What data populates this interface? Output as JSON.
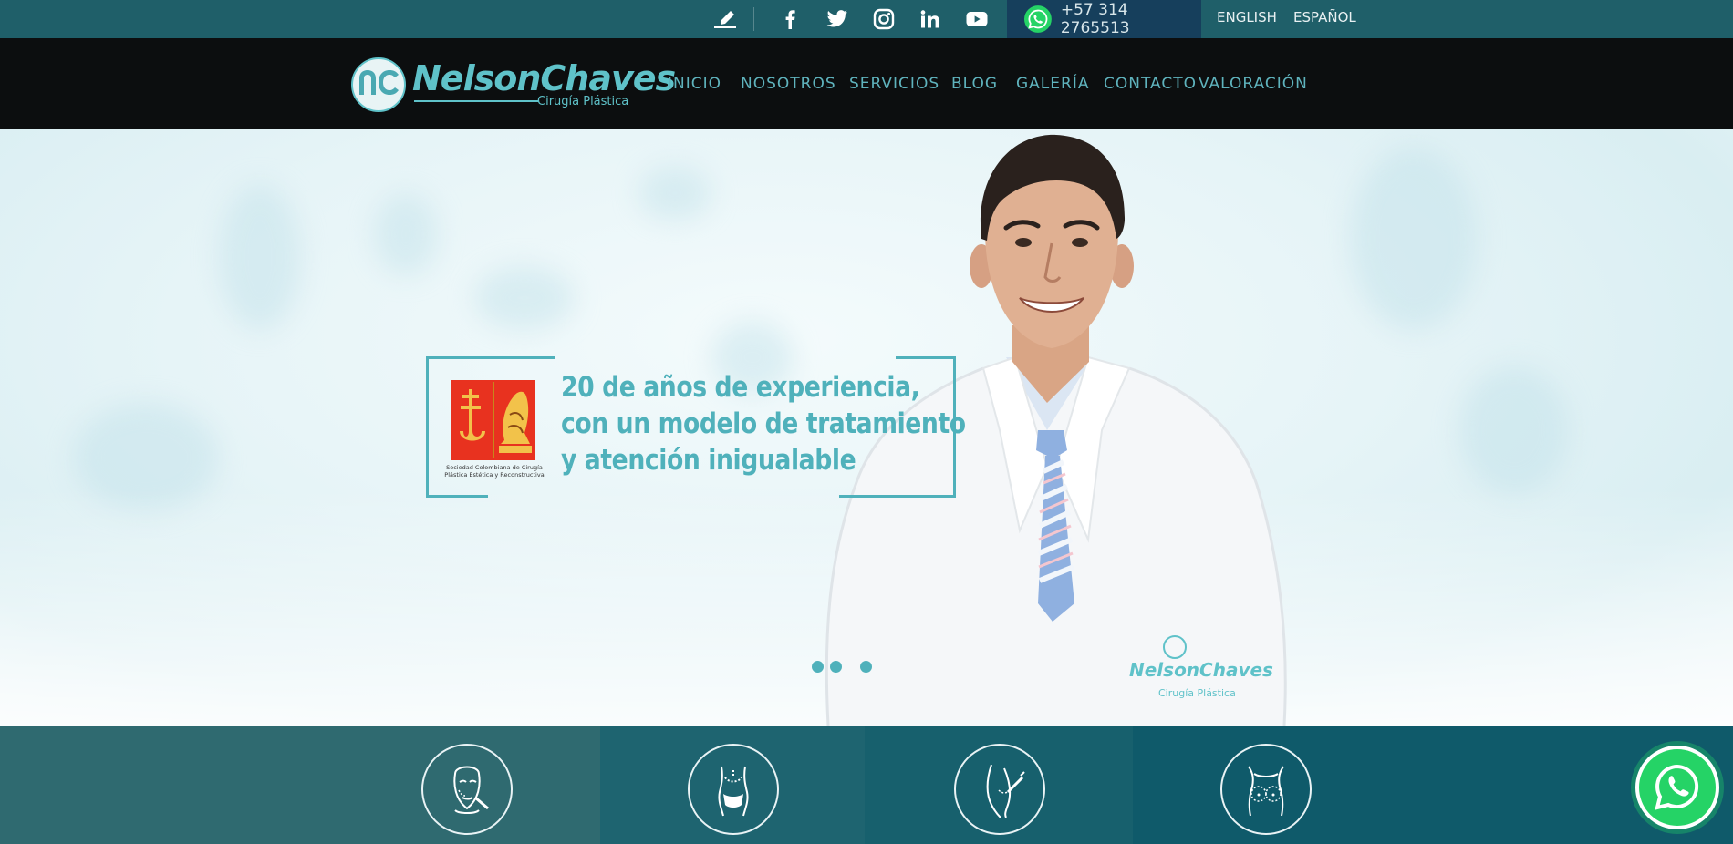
{
  "topbar": {
    "icons": [
      "pen-icon",
      "facebook-icon",
      "twitter-icon",
      "instagram-icon",
      "linkedin-icon",
      "youtube-icon",
      "whatsapp-icon"
    ],
    "phone": "+57 314 2765513",
    "languages": [
      "ENGLISH",
      "ESPAÑOL"
    ]
  },
  "header": {
    "logo": {
      "monogram": "nc",
      "name": "NelsonChaves",
      "subtitle": "Cirugía Plástica"
    },
    "nav": [
      "INICIO",
      "NOSOTROS",
      "SERVICIOS",
      "BLOG",
      "GALERÍA",
      "CONTACTO",
      "VALORACIÓN"
    ]
  },
  "hero": {
    "headline_lines": [
      "20 de años de experiencia,",
      "con un modelo de tratamiento",
      "y atención inigualable"
    ],
    "seal_caption": "Sociedad Colombiana de Cirugía Plástica Estética y Reconstructiva",
    "coat_logo_text": [
      "NelsonChaves",
      "Cirugía Plástica"
    ],
    "slider_dots": 3
  },
  "services": {
    "icons": [
      "face-surgery-icon",
      "body-contour-icon",
      "buttock-icon",
      "breast-icon"
    ]
  },
  "floating": {
    "icon": "whatsapp-icon"
  },
  "colors": {
    "topbar": "#1f5f69",
    "phone_box": "#163f5c",
    "header": "#0c0e0f",
    "accent": "#4fb1bb",
    "nav": "#5fb3bd",
    "strip": [
      "#2f6a70",
      "#1e6470",
      "#17606d",
      "#0f5a6a"
    ],
    "whatsapp": "#25d366",
    "seal": "#e8321f"
  }
}
